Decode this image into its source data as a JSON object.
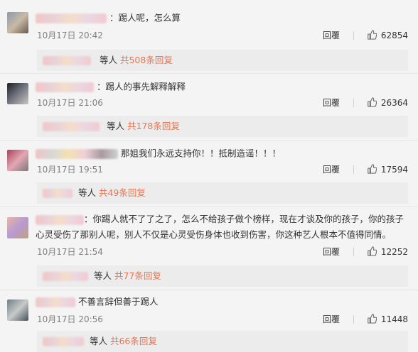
{
  "like_icon": "thumbs-up-icon",
  "accent_color": "#eb7350",
  "comments": [
    {
      "text": "：踢人呢，怎么算",
      "time": "10月17日 20:42",
      "reply_label": "回覆",
      "likes": "62854",
      "replies_prefix": "等人",
      "replies_count": "共508条回复"
    },
    {
      "text": "：踢人的事先解释解释",
      "time": "10月17日 21:06",
      "reply_label": "回覆",
      "likes": "26364",
      "replies_prefix": "等人",
      "replies_count": "共178条回复"
    },
    {
      "text": "那姐我们永远支持你！！抵制造谣！！！",
      "time": "10月17日 19:51",
      "reply_label": "回覆",
      "likes": "17594",
      "replies_prefix": "等人",
      "replies_count": "共49条回复"
    },
    {
      "text": "：你踢人就不了了之了，怎么不给孩子做个榜样，现在才谈及你的孩子，你的孩子心灵受伤了那别人呢，别人不仅是心灵受伤身体也收到伤害，你这种艺人根本不值得同情。",
      "time": "10月17日 21:54",
      "reply_label": "回覆",
      "likes": "12252",
      "replies_prefix": "等人",
      "replies_count": "共77条回复"
    },
    {
      "text": "不善言辞但善于踢人",
      "time": "10月17日 20:56",
      "reply_label": "回覆",
      "likes": "11448",
      "replies_prefix": "等人",
      "replies_count": "共66条回复"
    }
  ]
}
